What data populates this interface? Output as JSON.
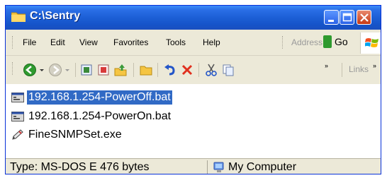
{
  "window": {
    "title": "C:\\Sentry",
    "folder_icon": "folder-icon"
  },
  "menu": {
    "file": "File",
    "edit": "Edit",
    "view": "View",
    "favorites": "Favorites",
    "tools": "Tools",
    "help": "Help",
    "address_label": "Address",
    "go_label": "Go"
  },
  "toolbar": {
    "icons": [
      "back-icon",
      "dropdown-arrow-icon",
      "forward-icon",
      "dropdown-arrow-icon",
      "copy-to-icon",
      "move-to-icon",
      "up-folder-icon",
      "folders-icon",
      "undo-icon",
      "delete-icon",
      "cut-icon",
      "copy-icon",
      "overflow-chevron-icon",
      "overflow-chevron-icon"
    ],
    "links_label": "Links"
  },
  "files": [
    {
      "name": "192.168.1.254-PowerOff.bat",
      "icon": "batch-file-icon",
      "selected": true
    },
    {
      "name": "192.168.1.254-PowerOn.bat",
      "icon": "batch-file-icon",
      "selected": false
    },
    {
      "name": "FineSNMPSet.exe",
      "icon": "pencil-exe-icon",
      "selected": false
    }
  ],
  "status": {
    "left": "Type: MS-DOS E 476 bytes",
    "right": "My Computer",
    "right_icon": "my-computer-icon"
  },
  "colors": {
    "titlebar": "#1c5fd6",
    "selection": "#316ac5",
    "chrome": "#ece9d8"
  }
}
